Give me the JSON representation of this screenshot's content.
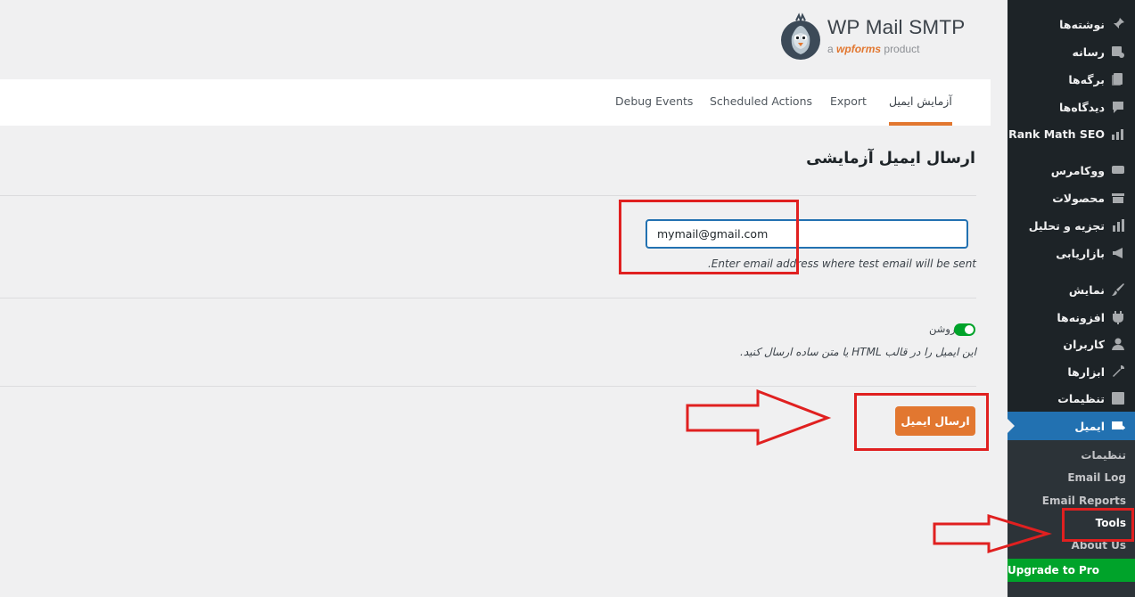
{
  "brand": {
    "title": "WP Mail SMTP",
    "sub_prefix": "a",
    "sub_wpforms": "wpforms",
    "sub_suffix": "product"
  },
  "tabs": [
    {
      "label": "آزمایش ایمیل",
      "active": true
    },
    {
      "label": "Export"
    },
    {
      "label": "Scheduled Actions"
    },
    {
      "label": "Debug Events"
    }
  ],
  "main": {
    "section_title": "ارسال ایمیل آزمایشی",
    "email_value": "mymail@gmail.com",
    "email_help": ".Enter email address where test email will be sent",
    "html_toggle_label": "روشن",
    "html_help": "این ایمیل را در قالب HTML یا متن ساده ارسال کنید.",
    "send_button": "ارسال ایمیل"
  },
  "sidebar": {
    "items": [
      {
        "label": "نوشته‌ها",
        "icon": "pin-icon"
      },
      {
        "label": "رسانه",
        "icon": "media-icon"
      },
      {
        "label": "برگه‌ها",
        "icon": "pages-icon"
      },
      {
        "label": "دیدگاه‌ها",
        "icon": "comments-icon"
      },
      {
        "label": "Rank Math SEO",
        "icon": "rankmath-icon"
      },
      {
        "label": "ووکامرس",
        "icon": "woo-icon"
      },
      {
        "label": "محصولات",
        "icon": "products-icon"
      },
      {
        "label": "تجزیه و تحلیل",
        "icon": "analytics-icon"
      },
      {
        "label": "بازاریابی",
        "icon": "megaphone-icon"
      },
      {
        "label": "نمایش",
        "icon": "brush-icon"
      },
      {
        "label": "افزونه‌ها",
        "icon": "plugin-icon"
      },
      {
        "label": "کاربران",
        "icon": "user-icon"
      },
      {
        "label": "ابزارها",
        "icon": "wrench-icon"
      },
      {
        "label": "تنظیمات",
        "icon": "settings-icon"
      },
      {
        "label": "ایمیل",
        "icon": "email-icon",
        "active": true
      }
    ],
    "submenu": [
      {
        "label": "تنظیمات"
      },
      {
        "label": "Email Log"
      },
      {
        "label": "Email Reports"
      },
      {
        "label": "Tools",
        "current": true
      },
      {
        "label": "About Us"
      }
    ],
    "upgrade": "Upgrade to Pro"
  },
  "colors": {
    "accent": "#e27730",
    "admin_blue": "#2271b1",
    "sidebar_bg": "#1d2327",
    "toggle_on": "#00a32a",
    "annotation_red": "#e02020"
  }
}
